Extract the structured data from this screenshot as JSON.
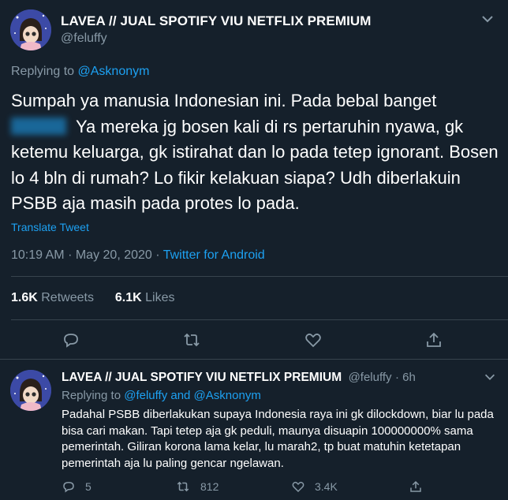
{
  "main_tweet": {
    "display_name": "LAVEA // JUAL SPOTIFY VIU NETFLIX PREMIUM",
    "handle": "@feluffy",
    "replying_label": "Replying to",
    "replying_to": "@Asknonym",
    "text_line1": "Sumpah ya manusia Indonesian ini. Pada bebal banget",
    "text_rest": "Ya mereka jg bosen kali di rs pertaruhin nyawa, gk ketemu keluarga, gk istirahat dan lo pada tetep ignorant. Bosen lo 4 bln di rumah? Lo fikir kelakuan siapa? Udh diberlakuin PSBB aja masih pada protes lo pada.",
    "translate_label": "Translate Tweet",
    "time": "10:19 AM",
    "date": "May 20, 2020",
    "source": "Twitter for Android",
    "retweets_count": "1.6K",
    "retweets_label": "Retweets",
    "likes_count": "6.1K",
    "likes_label": "Likes"
  },
  "reply_tweet": {
    "display_name": "LAVEA // JUAL SPOTIFY VIU NETFLIX PREMIUM",
    "handle": "@feluffy",
    "age": "6h",
    "replying_label": "Replying to",
    "replying_to": "@feluffy and @Asknonym",
    "text": "Padahal PSBB diberlakukan supaya Indonesia raya ini gk dilockdown, biar lu pada bisa cari makan. Tapi tetep aja gk peduli, maunya disuapin 100000000% sama pemerintah. Giliran korona lama kelar, lu marah2, tp buat matuhin ketetapan pemerintah aja lu paling gencar ngelawan.",
    "replies": "5",
    "retweets": "812",
    "likes": "3.4K"
  },
  "icons": [
    "chevron-down-icon",
    "reply-icon",
    "retweet-icon",
    "like-icon",
    "share-icon"
  ],
  "colors": {
    "background": "#15202b",
    "accent": "#1da1f2",
    "muted": "#8899a6",
    "divider": "#38444d"
  }
}
